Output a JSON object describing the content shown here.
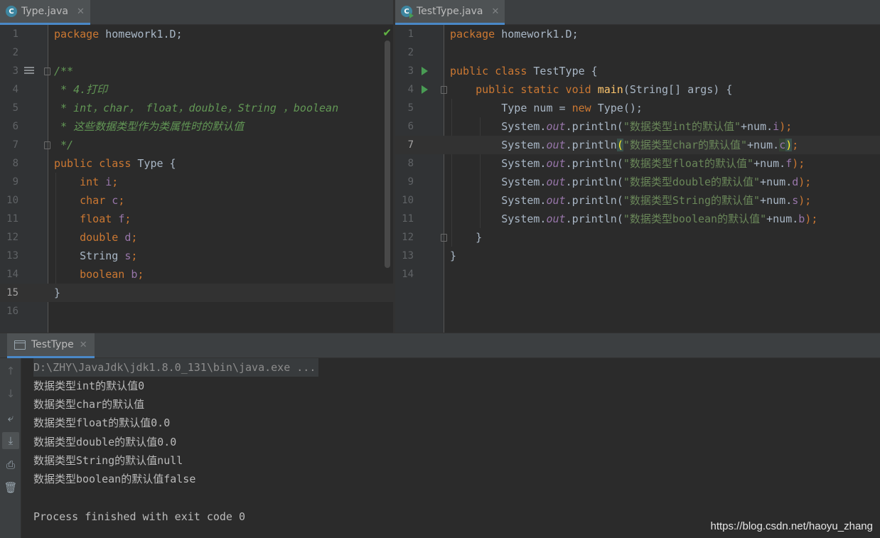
{
  "left_editor": {
    "tab_label": "Type.java",
    "tab_icon": "class-icon",
    "active_line": 15,
    "lines": [
      "1",
      "2",
      "3",
      "4",
      "5",
      "6",
      "7",
      "8",
      "9",
      "10",
      "11",
      "12",
      "13",
      "14",
      "15",
      "16"
    ]
  },
  "right_editor": {
    "tab_label": "TestType.java",
    "tab_icon": "runnable-class-icon",
    "active_line": 7,
    "lines": [
      "1",
      "2",
      "3",
      "4",
      "5",
      "6",
      "7",
      "8",
      "9",
      "10",
      "11",
      "12",
      "13",
      "14"
    ]
  },
  "left_code": {
    "l1_kw": "package",
    "l1_rest": " homework1.D;",
    "l3": "/**",
    "l4": " * 4.打印",
    "l5": " * int，char， float，double，String ，boolean",
    "l6": " * 这些数据类型作为类属性时的默认值",
    "l7": " */",
    "l8_kw": "public class",
    "l8_rest": " Type {",
    "l9_kw": "int",
    "l9_f": "i",
    "l10_kw": "char",
    "l10_f": "c",
    "l11_kw": "float",
    "l11_f": "f",
    "l12_kw": "double",
    "l12_f": "d",
    "l13_t": "String",
    "l13_f": "s",
    "l14_kw": "boolean",
    "l14_f": "b",
    "l15": "}"
  },
  "right_code": {
    "l1_kw": "package",
    "l1_rest": " homework1.D;",
    "l3_kw": "public class",
    "l3_rest": " TestType {",
    "l4_kw": "public static void",
    "l4_fn": "main",
    "l4_rest": "(String[] args) {",
    "l5_a": "Type num = ",
    "l5_kw": "new",
    "l5_b": " Type();",
    "sys": "System.",
    "out": "out",
    "println": ".println(",
    "l6_str": "\"数据类型int的默认值\"",
    "l6_f": "i",
    "l7_str": "\"数据类型char的默认值\"",
    "l7_f": "c",
    "l8_str": "\"数据类型float的默认值\"",
    "l8_f": "f",
    "l9_str": "\"数据类型double的默认值\"",
    "l9_f": "d",
    "l10_str": "\"数据类型String的默认值\"",
    "l10_f": "s",
    "l11_str": "\"数据类型boolean的默认值\"",
    "l11_f": "b",
    "plus_num": "+num.",
    "close": ");",
    "l12": "}",
    "l13": "}"
  },
  "run_panel": {
    "tab_label": "TestType",
    "output": [
      "D:\\ZHY\\JavaJdk\\jdk1.8.0_131\\bin\\java.exe ...",
      "数据类型int的默认值0",
      "数据类型char的默认值",
      "数据类型float的默认值0.0",
      "数据类型double的默认值0.0",
      "数据类型String的默认值null",
      "数据类型boolean的默认值false",
      "",
      "Process finished with exit code 0"
    ]
  },
  "watermark": "https://blog.csdn.net/haoyu_zhang",
  "colors": {
    "background": "#2b2b2b",
    "keyword": "#cc7832",
    "string": "#6a8759",
    "field": "#9876aa",
    "comment": "#629755",
    "method": "#ffc66d",
    "run_marker": "#499c54"
  }
}
